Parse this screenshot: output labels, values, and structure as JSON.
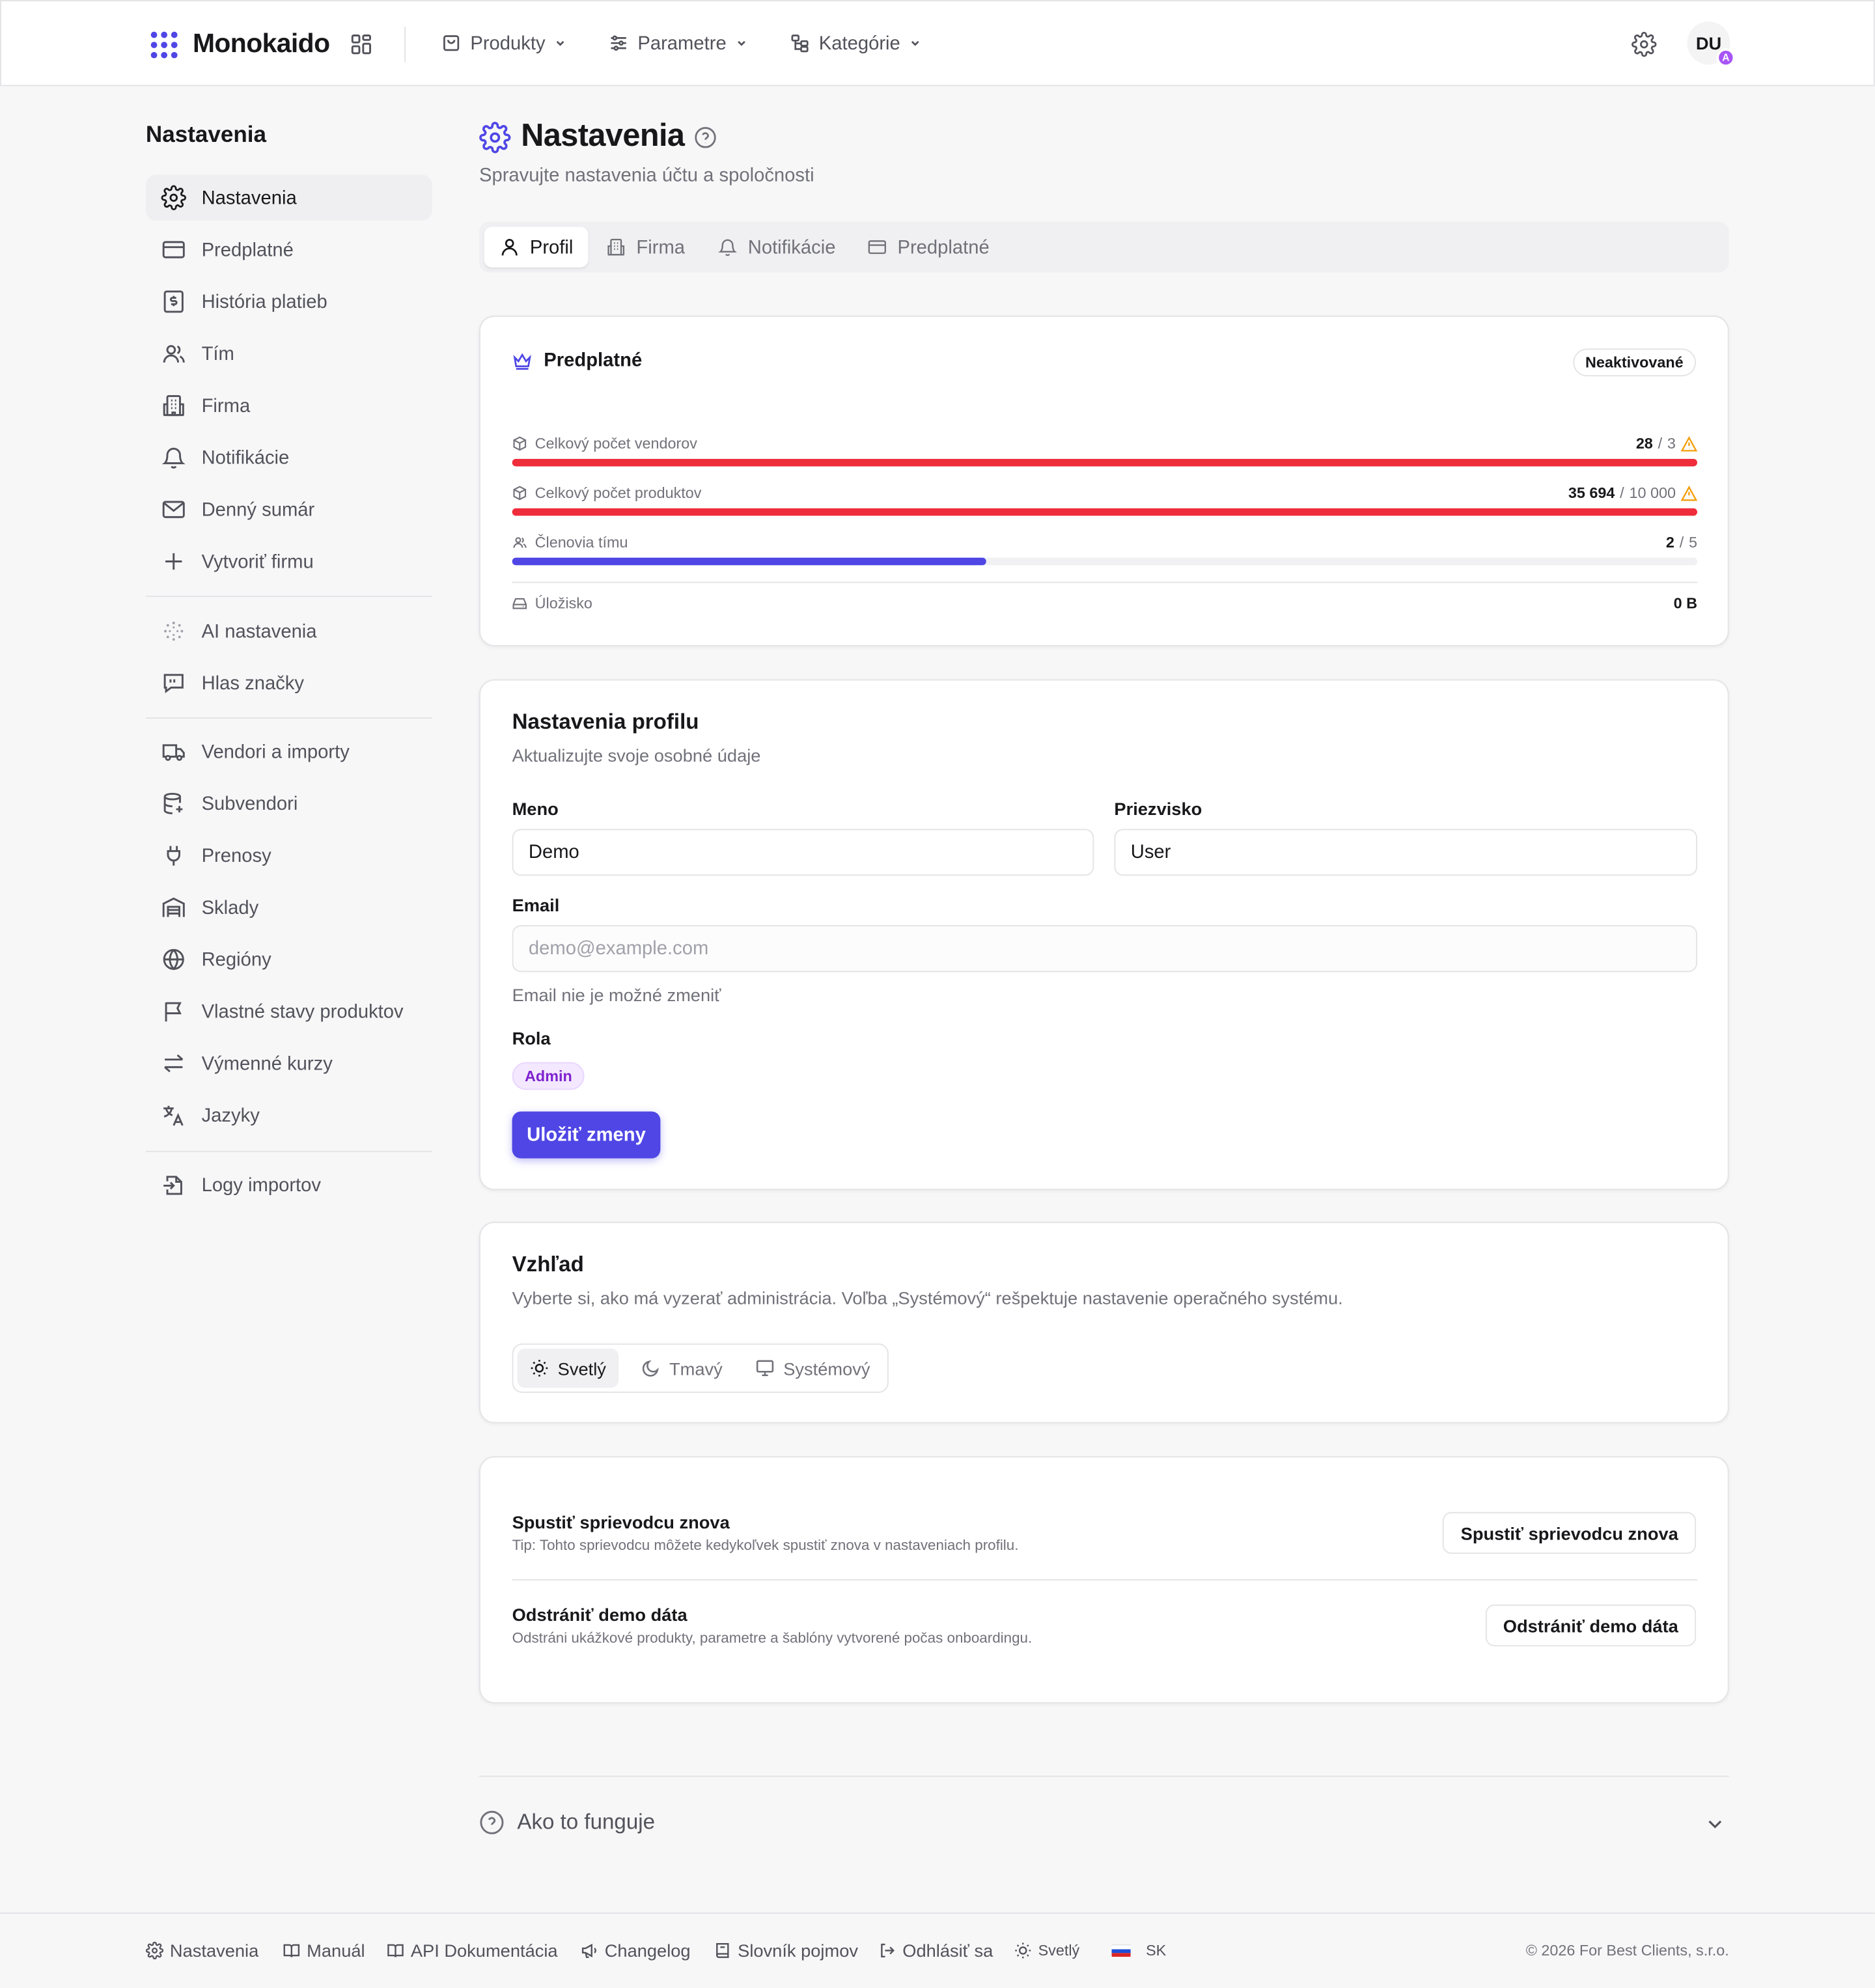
{
  "app": {
    "name": "Monokaido"
  },
  "header": {
    "nav": [
      {
        "label": "Produkty",
        "icon": "shopping-bag-icon"
      },
      {
        "label": "Parametre",
        "icon": "sliders-icon"
      },
      {
        "label": "Kategórie",
        "icon": "hierarchy-icon"
      }
    ],
    "avatar_initials": "DU",
    "avatar_badge": "A"
  },
  "sidebar": {
    "title": "Nastavenia",
    "groups": [
      [
        {
          "label": "Nastavenia",
          "icon": "gear-icon",
          "active": true
        },
        {
          "label": "Predplatné",
          "icon": "credit-card-icon"
        },
        {
          "label": "História platieb",
          "icon": "receipt-icon"
        },
        {
          "label": "Tím",
          "icon": "users-icon"
        },
        {
          "label": "Firma",
          "icon": "building-icon"
        },
        {
          "label": "Notifikácie",
          "icon": "bell-icon"
        },
        {
          "label": "Denný sumár",
          "icon": "mail-icon"
        },
        {
          "label": "Vytvoriť firmu",
          "icon": "plus-icon"
        }
      ],
      [
        {
          "label": "AI nastavenia",
          "icon": "ai-dots-icon"
        },
        {
          "label": "Hlas značky",
          "icon": "quote-message-icon"
        }
      ],
      [
        {
          "label": "Vendori a importy",
          "icon": "truck-icon"
        },
        {
          "label": "Subvendori",
          "icon": "database-icon"
        },
        {
          "label": "Prenosy",
          "icon": "plug-icon"
        },
        {
          "label": "Sklady",
          "icon": "warehouse-icon"
        },
        {
          "label": "Regióny",
          "icon": "globe-icon"
        },
        {
          "label": "Vlastné stavy produktov",
          "icon": "flag-icon"
        },
        {
          "label": "Výmenné kurzy",
          "icon": "exchange-icon"
        },
        {
          "label": "Jazyky",
          "icon": "translate-icon"
        }
      ],
      [
        {
          "label": "Logy importov",
          "icon": "file-import-icon"
        }
      ]
    ]
  },
  "page": {
    "title": "Nastavenia",
    "subtitle": "Spravujte nastavenia účtu a spoločnosti"
  },
  "tabs": [
    {
      "label": "Profil",
      "icon": "user-icon",
      "active": true
    },
    {
      "label": "Firma",
      "icon": "building-icon"
    },
    {
      "label": "Notifikácie",
      "icon": "bell-icon"
    },
    {
      "label": "Predplatné",
      "icon": "credit-card-icon"
    }
  ],
  "subscription": {
    "title": "Predplatné",
    "status": "Neaktivované",
    "usage": [
      {
        "label": "Celkový počet vendorov",
        "value": "28",
        "limit": "3",
        "fill": 1.0,
        "color": "#ef2d3a",
        "warning": true,
        "icon": "box-icon"
      },
      {
        "label": "Celkový počet produktov",
        "value": "35 694",
        "limit": "10 000",
        "fill": 1.0,
        "color": "#ef2d3a",
        "warning": true,
        "icon": "box-icon"
      },
      {
        "label": "Členovia tímu",
        "value": "2",
        "limit": "5",
        "fill": 0.4,
        "color": "#4f46e5",
        "warning": false,
        "icon": "users-icon"
      }
    ],
    "storage": {
      "label": "Úložisko",
      "value": "0 B"
    }
  },
  "profile": {
    "title": "Nastavenia profilu",
    "description": "Aktualizujte svoje osobné údaje",
    "first_name_label": "Meno",
    "first_name_value": "Demo",
    "last_name_label": "Priezvisko",
    "last_name_value": "User",
    "email_label": "Email",
    "email_placeholder": "demo@example.com",
    "email_hint": "Email nie je možné zmeniť",
    "role_label": "Rola",
    "role_value": "Admin",
    "save_label": "Uložiť zmeny"
  },
  "appearance": {
    "title": "Vzhľad",
    "description": "Vyberte si, ako má vyzerať administrácia. Voľba „Systémový“ rešpektuje nastavenie operačného systému.",
    "options": [
      {
        "label": "Svetlý",
        "icon": "sun-icon",
        "active": true
      },
      {
        "label": "Tmavý",
        "icon": "moon-icon"
      },
      {
        "label": "Systémový",
        "icon": "monitor-icon"
      }
    ]
  },
  "actions": [
    {
      "title": "Spustiť sprievodcu znova",
      "description": "Tip: Tohto sprievodcu môžete kedykoľvek spustiť znova v nastaveniach profilu.",
      "button": "Spustiť sprievodcu znova"
    },
    {
      "title": "Odstrániť demo dáta",
      "description": "Odstráni ukážkové produkty, parametre a šablóny vytvorené počas onboardingu.",
      "button": "Odstrániť demo dáta"
    }
  ],
  "how_it_works": {
    "label": "Ako to funguje"
  },
  "footer": {
    "links": [
      {
        "label": "Nastavenia",
        "icon": "gear-icon"
      },
      {
        "label": "Manuál",
        "icon": "book-icon"
      },
      {
        "label": "API Dokumentácia",
        "icon": "book-icon"
      },
      {
        "label": "Changelog",
        "icon": "megaphone-icon"
      },
      {
        "label": "Slovník pojmov",
        "icon": "dictionary-icon"
      },
      {
        "label": "Odhlásiť sa",
        "icon": "logout-icon"
      }
    ],
    "theme": "Svetlý",
    "language": "SK",
    "copyright": "© 2026 For Best Clients, s.r.o."
  },
  "colors": {
    "accent": "#4f46e5",
    "danger": "#ef2d3a",
    "warning": "#f59e0b",
    "role_badge": "#7e22ce"
  }
}
